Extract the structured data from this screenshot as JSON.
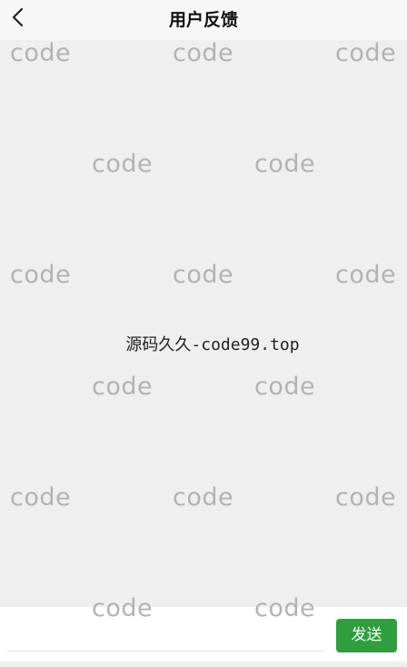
{
  "header": {
    "title": "用户反馈",
    "back_icon": "chevron-left-icon"
  },
  "watermark": {
    "text": "code"
  },
  "message": {
    "text": "源码久久-code99.top"
  },
  "input_bar": {
    "value": "",
    "placeholder": "",
    "send_label": "发送",
    "send_color": "#2e9e3e"
  }
}
